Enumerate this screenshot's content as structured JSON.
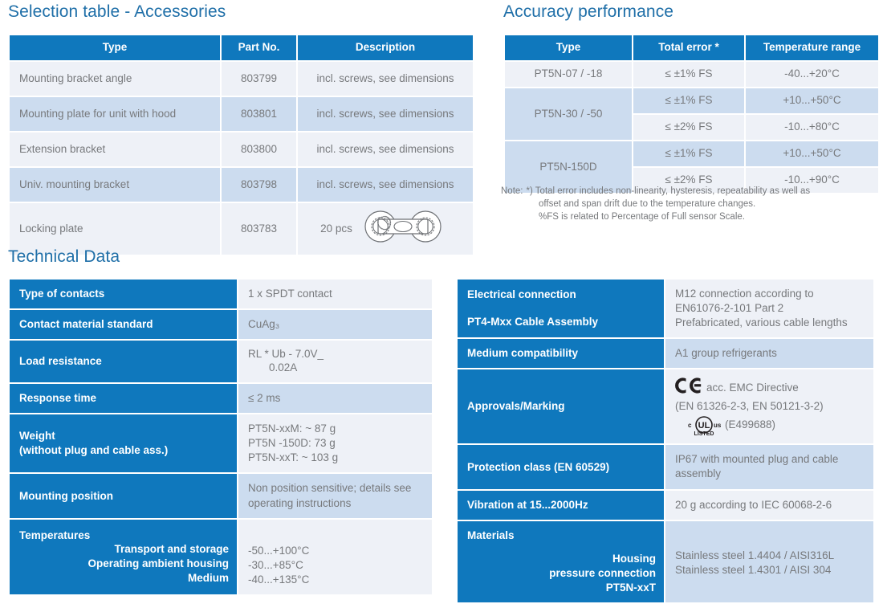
{
  "colors": {
    "header_blue": "#0f78bd",
    "heading_blue": "#1f6fa8",
    "row_light": "#eef1f7",
    "row_dark": "#ccdcef",
    "body_text": "#77797c"
  },
  "accessories": {
    "heading": "Selection table - Accessories",
    "columns": [
      "Type",
      "Part No.",
      "Description"
    ],
    "rows": [
      {
        "type": "Mounting bracket angle",
        "part_no": "803799",
        "description": "incl. screws, see dimensions"
      },
      {
        "type": "Mounting plate for unit with hood",
        "part_no": "803801",
        "description": "incl. screws, see dimensions"
      },
      {
        "type": "Extension bracket",
        "part_no": "803800",
        "description": "incl. screws, see dimensions"
      },
      {
        "type": "Univ. mounting bracket",
        "part_no": "803798",
        "description": "incl. screws, see dimensions"
      },
      {
        "type": "Locking plate",
        "part_no": "803783",
        "description": "20 pcs",
        "graphic": "locking-plate-figure-eight"
      }
    ]
  },
  "accuracy": {
    "heading": "Accuracy performance",
    "columns": [
      "Type",
      "Total error *",
      "Temperature range"
    ],
    "rows": [
      {
        "type": "PT5N-07 / -18",
        "span": 1,
        "entries": [
          {
            "error": "≤ ±1% FS",
            "temperature": "-40...+20°C"
          }
        ]
      },
      {
        "type": "PT5N-30 / -50",
        "span": 2,
        "entries": [
          {
            "error": "≤ ±1% FS",
            "temperature": "+10...+50°C"
          },
          {
            "error": "≤ ±2% FS",
            "temperature": "-10...+80°C"
          }
        ]
      },
      {
        "type": "PT5N-150D",
        "span": 2,
        "entries": [
          {
            "error": "≤ ±1% FS",
            "temperature": "+10...+50°C"
          },
          {
            "error": "≤ ±2% FS",
            "temperature": "-10...+90°C"
          }
        ]
      }
    ],
    "note_label": "Note:",
    "note_lines": [
      "*) Total error includes non-linearity, hysteresis, repeatability as well as",
      "offset and span drift due to the temperature changes.",
      "%FS is related to Percentage of Full sensor Scale."
    ]
  },
  "technical": {
    "heading": "Technical Data",
    "left_rows": [
      {
        "label": "Type of contacts",
        "value": "1 x SPDT contact"
      },
      {
        "label": "Contact material standard",
        "value": "CuAg₃"
      },
      {
        "label": "Load resistance",
        "value_numerator": "RL  *  Ub -  7.0V_",
        "value_denominator": "0.02A"
      },
      {
        "label": "Response time",
        "value": "≤ 2 ms"
      },
      {
        "label": "Weight",
        "label_line2": "(without plug and cable ass.)",
        "value_lines": [
          "PT5N-xxM: ~ 87 g",
          "PT5N -150D: 73 g",
          "PT5N-xxT: ~ 103 g"
        ]
      },
      {
        "label": "Mounting position",
        "value_lines": [
          "Non position sensitive; details see",
          "operating instructions"
        ]
      },
      {
        "label": "Temperatures",
        "sub_labels": [
          "Transport and storage",
          "Operating ambient housing",
          "Medium"
        ],
        "value_lines": [
          "-50...+100°C",
          "-30...+85°C",
          "-40...+135°C"
        ]
      }
    ],
    "right_rows": [
      {
        "label": "Electrical connection",
        "label_line2": "PT4-Mxx Cable Assembly",
        "value_lines": [
          "M12 connection according to",
          "EN61076-2-101 Part 2",
          "Prefabricated, various cable lengths"
        ]
      },
      {
        "label": "Medium compatibility",
        "value": "A1 group refrigerants"
      },
      {
        "label": "Approvals/Marking",
        "approval": {
          "ce_text": "acc. EMC Directive",
          "standards": "(EN 61326-2-3, EN 50121-3-2)",
          "ul_text": "(E499688)",
          "ul_listed": "LISTED",
          "ul_c": "c",
          "ul_us": "us",
          "ul_letters": "UL"
        }
      },
      {
        "label": "Protection class (EN 60529)",
        "value_lines": [
          "IP67 with mounted plug and cable",
          "assembly"
        ]
      },
      {
        "label": "Vibration at 15...2000Hz",
        "value": "20 g according to IEC 60068-2-6"
      },
      {
        "label": "Materials",
        "sub_labels": [
          "Housing",
          "pressure connection",
          "PT5N-xxT"
        ],
        "value_lines": [
          "Stainless steel 1.4404 / AISI316L",
          "Stainless steel 1.4301 / AISI 304"
        ]
      }
    ]
  }
}
